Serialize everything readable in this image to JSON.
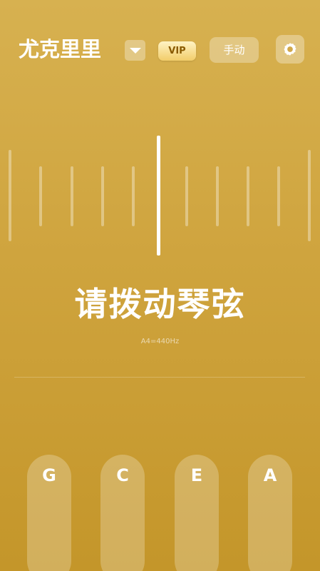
{
  "header": {
    "instrument_name": "尤克里里",
    "vip_label": "VIP",
    "mode_label": "手动",
    "dropdown_icon": "triangle-down-icon",
    "settings_icon": "gear-icon"
  },
  "tuner": {
    "prompt": "请拨动琴弦",
    "reference": "A4=440Hz"
  },
  "strings": [
    {
      "label": "G"
    },
    {
      "label": "C"
    },
    {
      "label": "E"
    },
    {
      "label": "A"
    }
  ],
  "colors": {
    "background_top": "#d7b150",
    "background_bottom": "#c4962a",
    "vip_text": "#8a5a00",
    "foreground": "#ffffff"
  }
}
